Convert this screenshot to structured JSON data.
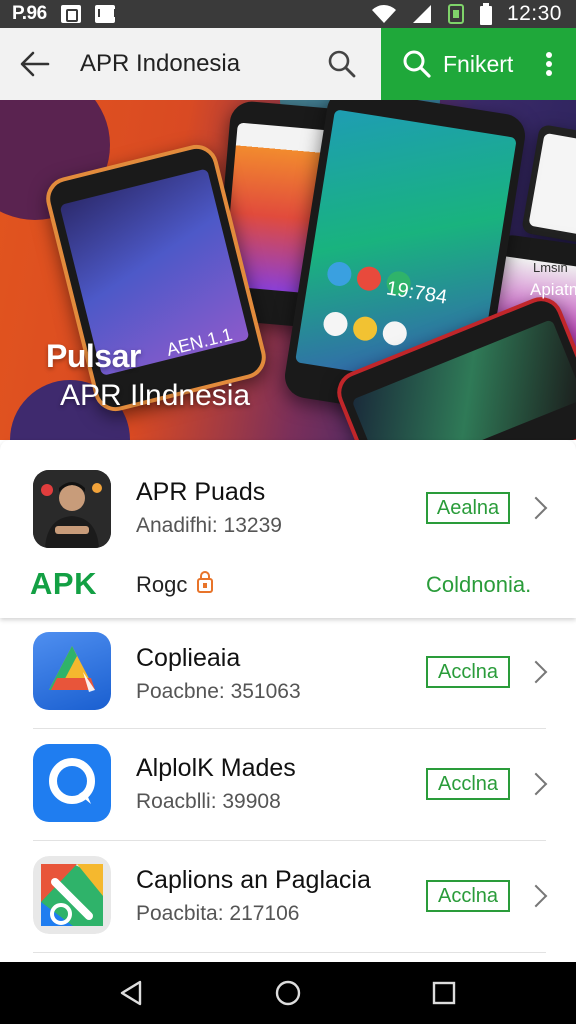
{
  "status_bar": {
    "carrier": "P.96",
    "time": "12:30"
  },
  "app_bar": {
    "title": "APR Indonesia",
    "search_label": "Fnikert"
  },
  "banner": {
    "title_line1": "Pulsar",
    "title_line2": "APR Ilndnesia",
    "phone_text_1": "AEN.1.1",
    "phone_text_2": "19:784",
    "phone_text_3": "Apiatm",
    "phone_text_4": "Lmsin"
  },
  "featured": {
    "name": "APR Puads",
    "sub": "Anadifhi: 13239",
    "badge": "Aealna",
    "apk_logo": "APK",
    "apk_text": "Rogc",
    "apk_link": "Coldnonia."
  },
  "apps": [
    {
      "name": "Coplieaia",
      "sub": "Poacbne: 351063",
      "badge": "Acclna",
      "icon": "google-drive-like-icon"
    },
    {
      "name": "AlplolK Mades",
      "sub": "Roacblli: 39908",
      "badge": "Acclna",
      "icon": "chat-bubble-icon"
    },
    {
      "name": "Caplions an Paglacia",
      "sub": "Poacbita: 217106",
      "badge": "Acclna",
      "icon": "maps-like-icon"
    }
  ],
  "colors": {
    "accent_green": "#1fa83a",
    "status_bar": "#3a3a3a",
    "app_bar": "#f2f2f2"
  }
}
